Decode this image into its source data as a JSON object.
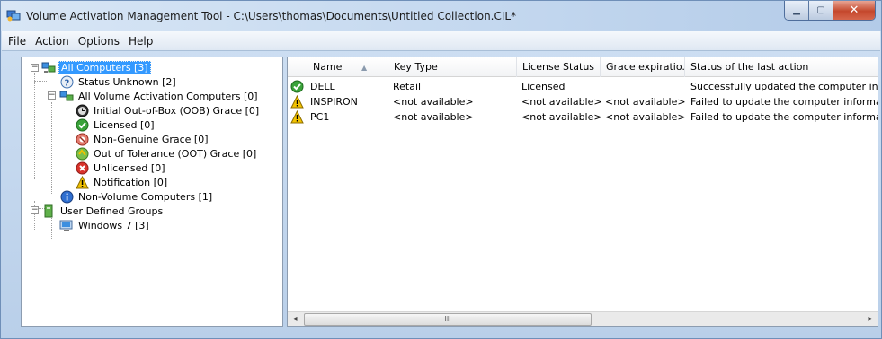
{
  "window": {
    "title": "Volume Activation Management Tool - C:\\Users\\thomas\\Documents\\Untitled Collection.CIL*"
  },
  "menu": [
    "File",
    "Action",
    "Options",
    "Help"
  ],
  "tree": {
    "all_computers": "All Computers [3]",
    "status_unknown": "Status Unknown [2]",
    "all_volume": "All Volume Activation Computers [0]",
    "oob_grace": "Initial Out-of-Box (OOB) Grace [0]",
    "licensed": "Licensed [0]",
    "non_genuine": "Non-Genuine Grace [0]",
    "oot_grace": "Out of Tolerance (OOT) Grace [0]",
    "unlicensed": "Unlicensed [0]",
    "notification": "Notification [0]",
    "non_volume": "Non-Volume Computers [1]",
    "user_groups": "User Defined Groups",
    "windows7": "Windows 7 [3]"
  },
  "list": {
    "columns": [
      "Name",
      "Key Type",
      "License Status",
      "Grace expiratio...",
      "Status of the last action"
    ],
    "rows": [
      {
        "status": "ok",
        "name": "DELL",
        "key_type": "Retail",
        "license": "Licensed",
        "grace": "",
        "last_action": "Successfully updated the computer inforn"
      },
      {
        "status": "warn",
        "name": "INSPIRON",
        "key_type": "<not available>",
        "license": "<not available>",
        "grace": "<not available>",
        "last_action": "Failed to update the computer informatio"
      },
      {
        "status": "warn",
        "name": "PC1",
        "key_type": "<not available>",
        "license": "<not available>",
        "grace": "<not available>",
        "last_action": "Failed to update the computer informatio"
      }
    ]
  },
  "scrollbar": {
    "left_arrow": "◂",
    "right_arrow": "▸",
    "grip": "III"
  },
  "colors": {
    "selection": "#3399ff",
    "ok": "#3aa33a",
    "warn": "#f2c200",
    "error": "#d9322b"
  }
}
